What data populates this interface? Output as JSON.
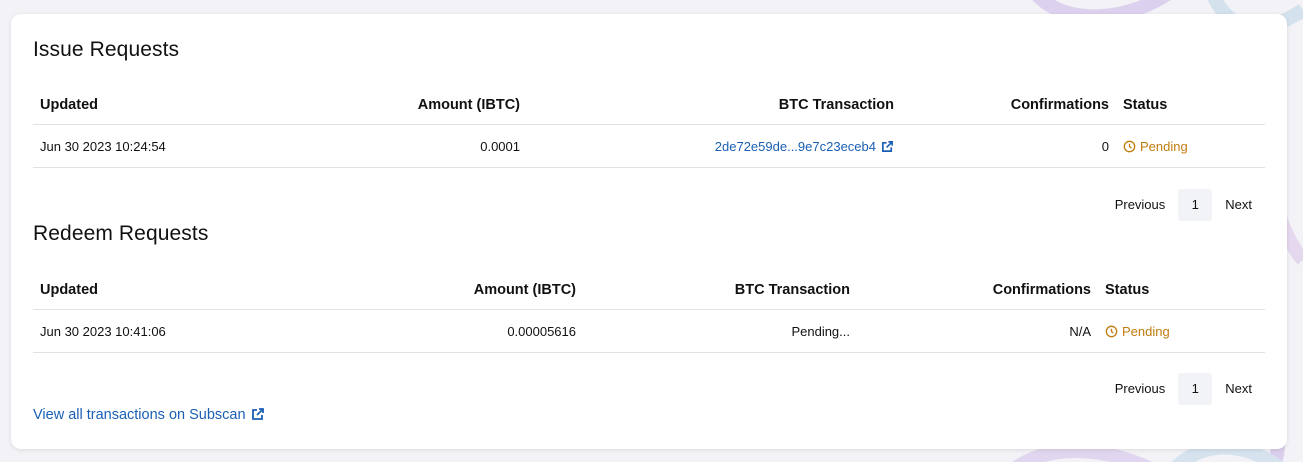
{
  "issue": {
    "title": "Issue Requests",
    "columns": [
      "Updated",
      "Amount (IBTC)",
      "BTC Transaction",
      "Confirmations",
      "Status"
    ],
    "rows": [
      {
        "updated": "Jun 30 2023 10:24:54",
        "amount": "0.0001",
        "btc_transaction": "2de72e59de...9e7c23eceb4",
        "confirmations": "0",
        "status": "Pending"
      }
    ],
    "pagination": {
      "previous": "Previous",
      "page": "1",
      "next": "Next"
    }
  },
  "redeem": {
    "title": "Redeem Requests",
    "columns": [
      "Updated",
      "Amount (IBTC)",
      "BTC Transaction",
      "Confirmations",
      "Status"
    ],
    "rows": [
      {
        "updated": "Jun 30 2023 10:41:06",
        "amount": "0.00005616",
        "btc_transaction": "Pending...",
        "confirmations": "N/A",
        "status": "Pending"
      }
    ],
    "pagination": {
      "previous": "Previous",
      "page": "1",
      "next": "Next"
    }
  },
  "footer": {
    "subscan_link": "View all transactions on Subscan"
  },
  "colors": {
    "link": "#1a5fb4",
    "pending": "#c27c0e",
    "background": "#f3f2f6",
    "card": "#ffffff"
  },
  "icons": [
    "external-link-icon",
    "clock-icon"
  ]
}
